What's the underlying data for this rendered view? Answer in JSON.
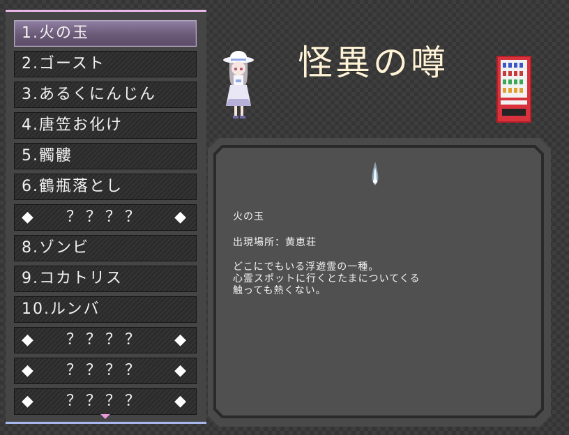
{
  "menu": {
    "items": [
      {
        "label": "1.火の玉",
        "selected": true,
        "locked": false
      },
      {
        "label": "2.ゴースト",
        "locked": false
      },
      {
        "label": "3.あるくにんじん",
        "locked": false
      },
      {
        "label": "4.唐笠お化け",
        "locked": false
      },
      {
        "label": "5.髑髏",
        "locked": false
      },
      {
        "label": "6.鶴瓶落とし",
        "locked": false
      },
      {
        "label": "？？？？",
        "locked": true,
        "marker": "◆"
      },
      {
        "label": "8.ゾンビ",
        "locked": false
      },
      {
        "label": "9.コカトリス",
        "locked": false
      },
      {
        "label": "10.ルンバ",
        "locked": false
      },
      {
        "label": "？？？？",
        "locked": true,
        "marker": "◆"
      },
      {
        "label": "？？？？",
        "locked": true,
        "marker": "◆"
      },
      {
        "label": "？？？？",
        "locked": true,
        "marker": "◆"
      }
    ],
    "accent_top": "#e6b6e6",
    "accent_bottom": "#a8b8ee",
    "scroll_arrow_color": "#e89ad8",
    "scroll_arrow_icon": "triangle-down-icon"
  },
  "header": {
    "title": "怪異の噂",
    "title_color": "#fff3d6"
  },
  "detail": {
    "name": "火の玉",
    "location": "出現場所：黄恵荘",
    "description": [
      "どこにでもいる浮遊霊の一種。",
      "心霊スポットに行くとたまについてくる",
      "触っても熱くない。"
    ],
    "sprite_icon": "wisp-flame-icon"
  },
  "sprites": {
    "character": "girl-in-white-hat-sprite",
    "vending": "vending-machine-sprite"
  }
}
